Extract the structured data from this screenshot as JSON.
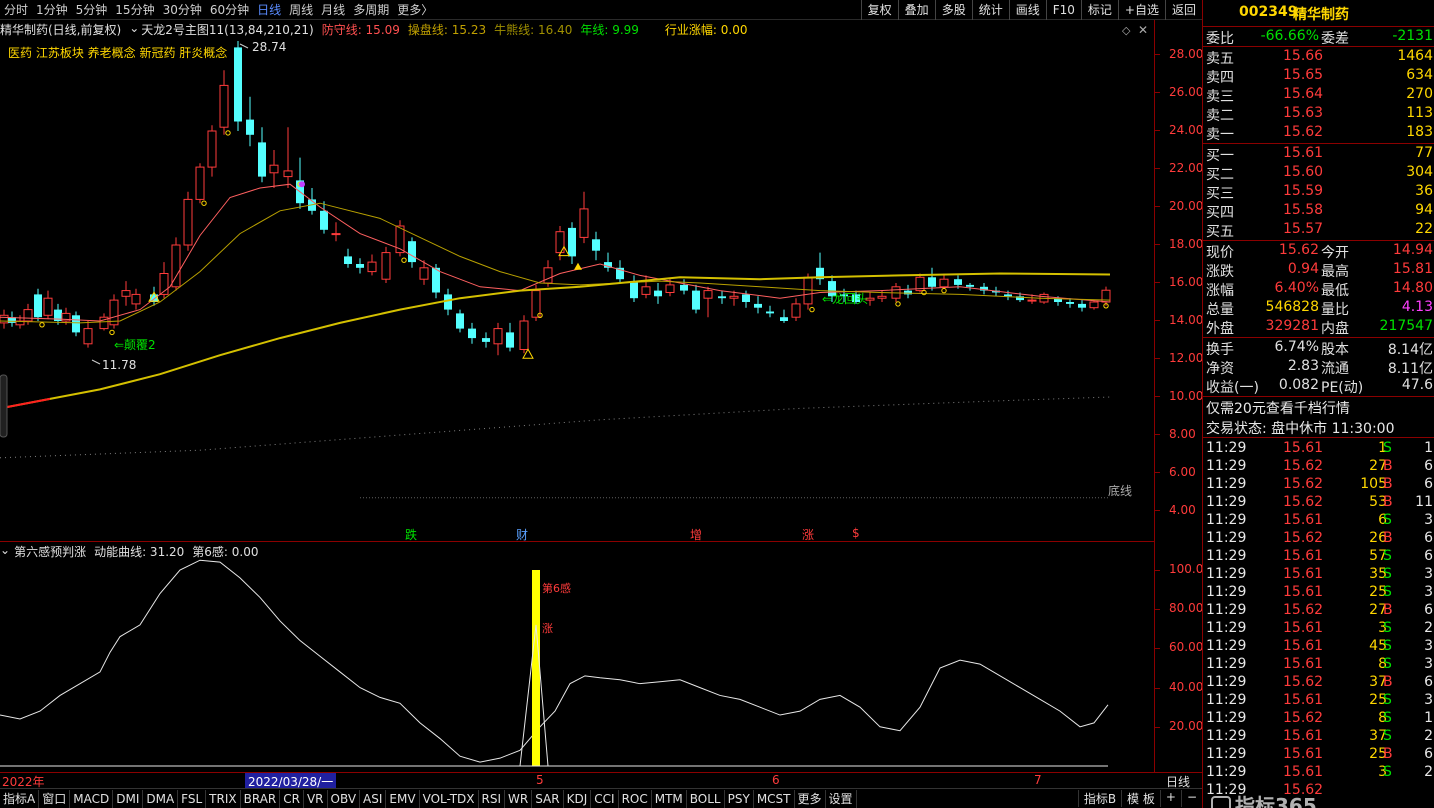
{
  "topbar": {
    "tabs": [
      "分时",
      "1分钟",
      "5分钟",
      "15分钟",
      "30分钟",
      "60分钟",
      "日线",
      "周线",
      "月线",
      "多周期",
      "更多〉"
    ],
    "active_tab": "日线",
    "tools": [
      "复权",
      "叠加",
      "多股",
      "统计",
      "画线",
      "F10",
      "标记",
      "+自选",
      "返回"
    ]
  },
  "chart_header": {
    "stock_mode": "精华制药(日线,前复权)",
    "indicator": "天龙2号主图11(13,84,210,21)",
    "fangshou_label": "防守线: 15.09",
    "caopan_label": "操盘线: 15.23",
    "niuxiong_label": "牛熊线: 16.40",
    "nianxian_label": "年线: 9.99",
    "industry_label": "行业涨幅: 0.00",
    "concepts": "医药 江苏板块 养老概念 新冠药 肝炎概念"
  },
  "annotations": {
    "high": "28.74",
    "low": "11.78",
    "signal1": "⇐颠覆2",
    "signal2": "⇐龙回头",
    "bottom_line": "底线",
    "markers": [
      {
        "text": "跌",
        "color": "#00e000"
      },
      {
        "text": "财",
        "color": "#5aa0ff"
      },
      {
        "text": "增",
        "color": "#ff3b3b"
      },
      {
        "text": "涨",
        "color": "#ff3b3b"
      },
      {
        "text": "$",
        "color": "#ff3b3b"
      }
    ]
  },
  "yaxis_main": [
    "28.00",
    "26.00",
    "24.00",
    "22.00",
    "20.00",
    "18.00",
    "16.00",
    "14.00",
    "12.00",
    "10.00",
    "8.00",
    "6.00",
    "4.00"
  ],
  "indicator_header": {
    "name": "第六感预判涨",
    "curve": "动能曲线: 31.20",
    "sixth": "第6感: 0.00",
    "spike_label1": "第6感",
    "spike_label2": "涨"
  },
  "yaxis_ind": [
    "100.0",
    "80.00",
    "60.00",
    "40.00",
    "20.00"
  ],
  "xaxis": {
    "year": "2022年",
    "cursor_date": "2022/03/28/一",
    "months": [
      "5",
      "6",
      "7"
    ],
    "period": "日线"
  },
  "bottombar": [
    "指标A",
    "窗口",
    "MACD",
    "DMI",
    "DMA",
    "FSL",
    "TRIX",
    "BRAR",
    "CR",
    "VR",
    "OBV",
    "ASI",
    "EMV",
    "VOL-TDX",
    "RSI",
    "WR",
    "SAR",
    "KDJ",
    "CCI",
    "ROC",
    "MTM",
    "BOLL",
    "PSY",
    "MCST",
    "更多",
    "设置"
  ],
  "bottom_right": [
    "指标B",
    "模 板",
    "+",
    "−"
  ],
  "stock": {
    "code": "002349",
    "name": "精华制药"
  },
  "weibi": {
    "label": "委比",
    "value": "-66.66%",
    "label2": "委差",
    "value2": "-2131"
  },
  "sell": [
    {
      "label": "卖五",
      "price": "15.66",
      "vol": "1464"
    },
    {
      "label": "卖四",
      "price": "15.65",
      "vol": "634"
    },
    {
      "label": "卖三",
      "price": "15.64",
      "vol": "270"
    },
    {
      "label": "卖二",
      "price": "15.63",
      "vol": "113"
    },
    {
      "label": "卖一",
      "price": "15.62",
      "vol": "183"
    }
  ],
  "buy": [
    {
      "label": "买一",
      "price": "15.61",
      "vol": "77"
    },
    {
      "label": "买二",
      "price": "15.60",
      "vol": "304"
    },
    {
      "label": "买三",
      "price": "15.59",
      "vol": "36"
    },
    {
      "label": "买四",
      "price": "15.58",
      "vol": "94"
    },
    {
      "label": "买五",
      "price": "15.57",
      "vol": "22"
    }
  ],
  "quote": [
    {
      "l1": "现价",
      "v1": "15.62",
      "l2": "今开",
      "v2": "14.94",
      "c1": "red",
      "c2": "red"
    },
    {
      "l1": "涨跌",
      "v1": "0.94",
      "l2": "最高",
      "v2": "15.81",
      "c1": "red",
      "c2": "red"
    },
    {
      "l1": "涨幅",
      "v1": "6.40%",
      "l2": "最低",
      "v2": "14.80",
      "c1": "red",
      "c2": "red"
    },
    {
      "l1": "总量",
      "v1": "546828",
      "l2": "量比",
      "v2": "4.13",
      "c1": "yellow",
      "c2": "mag"
    },
    {
      "l1": "外盘",
      "v1": "329281",
      "l2": "内盘",
      "v2": "217547",
      "c1": "red",
      "c2": "green"
    }
  ],
  "finance": [
    {
      "l1": "换手",
      "v1": "6.74%",
      "l2": "股本",
      "v2": "8.14亿"
    },
    {
      "l1": "净资",
      "v1": "2.83",
      "l2": "流通",
      "v2": "8.11亿"
    },
    {
      "l1": "收益(一)",
      "v1": "0.082",
      "l2": "PE(动)",
      "v2": "47.6"
    }
  ],
  "promo": "仅需20元查看千档行情",
  "trade_status": "交易状态: 盘中休市 11:30:00",
  "ticks": [
    {
      "t": "11:29",
      "p": "15.61",
      "v": "1",
      "s": "S",
      "n": "1"
    },
    {
      "t": "11:29",
      "p": "15.62",
      "v": "27",
      "s": "B",
      "n": "6"
    },
    {
      "t": "11:29",
      "p": "15.62",
      "v": "105",
      "s": "B",
      "n": "6"
    },
    {
      "t": "11:29",
      "p": "15.62",
      "v": "53",
      "s": "B",
      "n": "11"
    },
    {
      "t": "11:29",
      "p": "15.61",
      "v": "6",
      "s": "S",
      "n": "3"
    },
    {
      "t": "11:29",
      "p": "15.62",
      "v": "26",
      "s": "B",
      "n": "6"
    },
    {
      "t": "11:29",
      "p": "15.61",
      "v": "57",
      "s": "S",
      "n": "6"
    },
    {
      "t": "11:29",
      "p": "15.61",
      "v": "35",
      "s": "S",
      "n": "3"
    },
    {
      "t": "11:29",
      "p": "15.61",
      "v": "25",
      "s": "S",
      "n": "3"
    },
    {
      "t": "11:29",
      "p": "15.62",
      "v": "27",
      "s": "B",
      "n": "6"
    },
    {
      "t": "11:29",
      "p": "15.61",
      "v": "3",
      "s": "S",
      "n": "2"
    },
    {
      "t": "11:29",
      "p": "15.61",
      "v": "45",
      "s": "S",
      "n": "3"
    },
    {
      "t": "11:29",
      "p": "15.61",
      "v": "8",
      "s": "S",
      "n": "3"
    },
    {
      "t": "11:29",
      "p": "15.62",
      "v": "37",
      "s": "B",
      "n": "6"
    },
    {
      "t": "11:29",
      "p": "15.61",
      "v": "25",
      "s": "S",
      "n": "3"
    },
    {
      "t": "11:29",
      "p": "15.62",
      "v": "8",
      "s": "S",
      "n": "1"
    },
    {
      "t": "11:29",
      "p": "15.61",
      "v": "37",
      "s": "S",
      "n": "2"
    },
    {
      "t": "11:29",
      "p": "15.61",
      "v": "25",
      "s": "B",
      "n": "6"
    },
    {
      "t": "11:29",
      "p": "15.61",
      "v": "3",
      "s": "S",
      "n": "2"
    },
    {
      "t": "11:29",
      "p": "15.62",
      "v": "",
      "s": "",
      "n": ""
    }
  ],
  "watermark": "指标365",
  "colors": {
    "up": "#ff3b3b",
    "down": "#54ffff",
    "ma_yellow": "#d4c000",
    "ma_red": "#ff6060",
    "ma_olive": "#b8a000",
    "grid": "#8b0000"
  }
}
